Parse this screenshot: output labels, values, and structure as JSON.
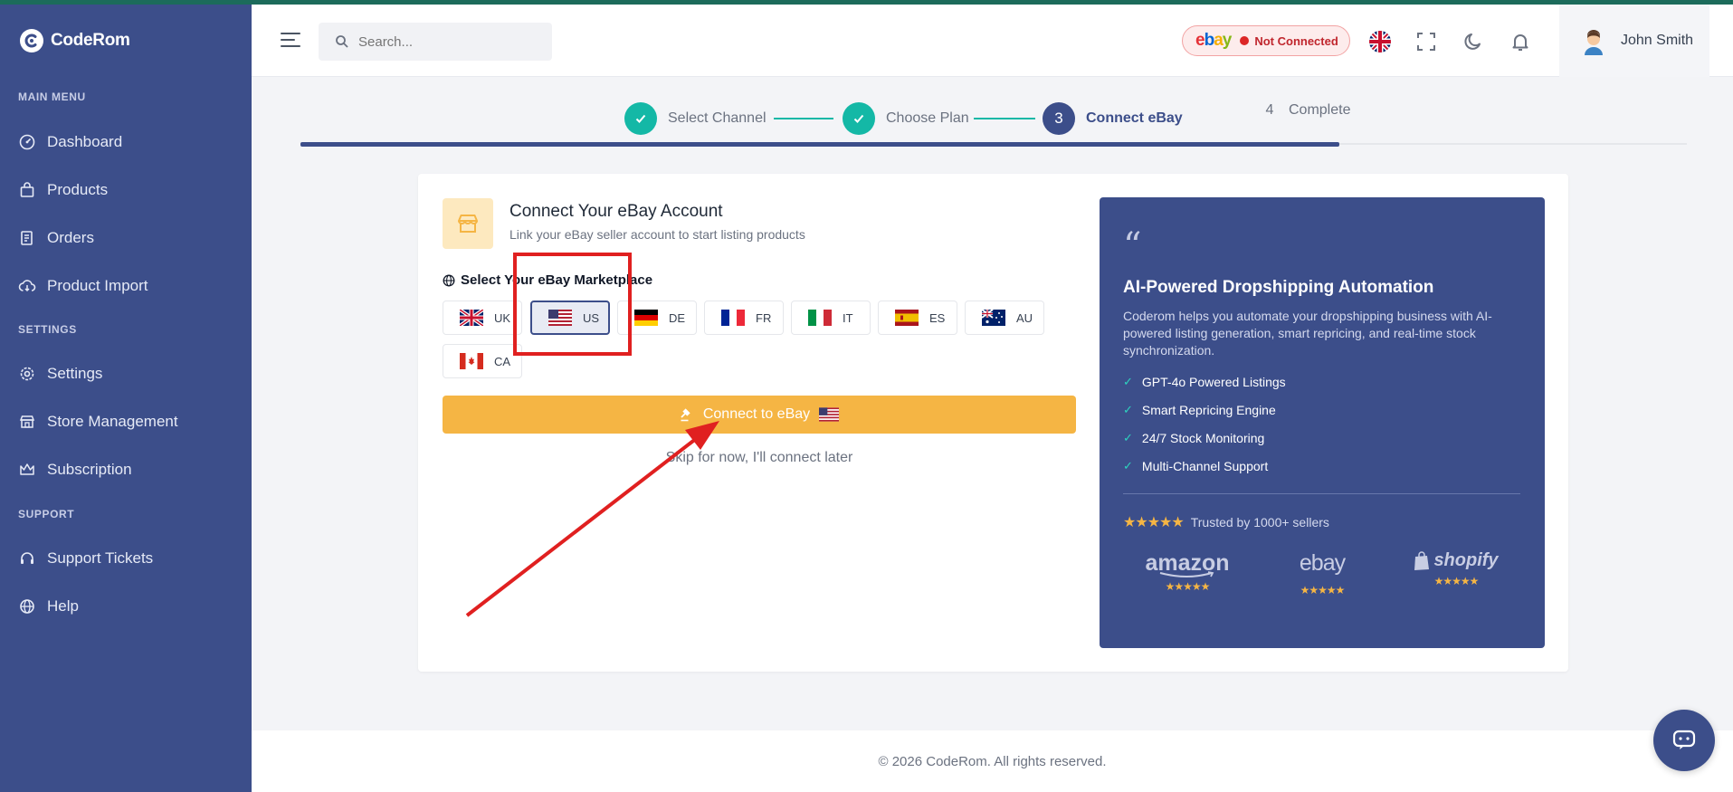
{
  "app": {
    "name": "CodeRom"
  },
  "sidebar": {
    "sections": [
      {
        "title": "MAIN MENU",
        "items": [
          {
            "label": "Dashboard",
            "icon": "dashboard-icon"
          },
          {
            "label": "Products",
            "icon": "bag-icon"
          },
          {
            "label": "Orders",
            "icon": "receipt-icon"
          },
          {
            "label": "Product Import",
            "icon": "cloud-download-icon"
          }
        ]
      },
      {
        "title": "SETTINGS",
        "items": [
          {
            "label": "Settings",
            "icon": "gear-icon"
          },
          {
            "label": "Store Management",
            "icon": "store-icon"
          },
          {
            "label": "Subscription",
            "icon": "crown-icon"
          }
        ]
      },
      {
        "title": "SUPPORT",
        "items": [
          {
            "label": "Support Tickets",
            "icon": "headset-icon"
          },
          {
            "label": "Help",
            "icon": "globe-icon"
          }
        ]
      }
    ]
  },
  "header": {
    "search_placeholder": "Search...",
    "ebay_status": "Not Connected",
    "user_name": "John Smith"
  },
  "stepper": {
    "steps": [
      {
        "label": "Select Channel",
        "state": "done"
      },
      {
        "label": "Choose Plan",
        "state": "done"
      },
      {
        "number": "3",
        "label": "Connect eBay",
        "state": "active"
      },
      {
        "number": "4",
        "label": "Complete",
        "state": "pending"
      }
    ],
    "progress_percent": 75
  },
  "connect": {
    "title": "Connect Your eBay Account",
    "subtitle": "Link your eBay seller account to start listing products",
    "marketplace_label": "Select Your eBay Marketplace",
    "marketplaces": [
      "UK",
      "US",
      "DE",
      "FR",
      "IT",
      "ES",
      "AU",
      "CA"
    ],
    "selected_marketplace": "US",
    "connect_button": "Connect to eBay",
    "skip_link": "Skip for now, I'll connect later"
  },
  "info": {
    "title": "AI-Powered Dropshipping Automation",
    "description": "Coderom helps you automate your dropshipping business with AI-powered listing generation, smart repricing, and real-time stock synchronization.",
    "features": [
      "GPT-4o Powered Listings",
      "Smart Repricing Engine",
      "24/7 Stock Monitoring",
      "Multi-Channel Support"
    ],
    "trust_text": "Trusted by 1000+ sellers",
    "rating_stars": "★★★★★",
    "brands": [
      "amazon",
      "ebay",
      "shopify"
    ]
  },
  "footer": {
    "text": "© 2026 CodeRom. All rights reserved."
  },
  "colors": {
    "sidebar": "#3c4e8a",
    "accent": "#14b8a6",
    "cta": "#f5b544",
    "annotation": "#e02020"
  }
}
